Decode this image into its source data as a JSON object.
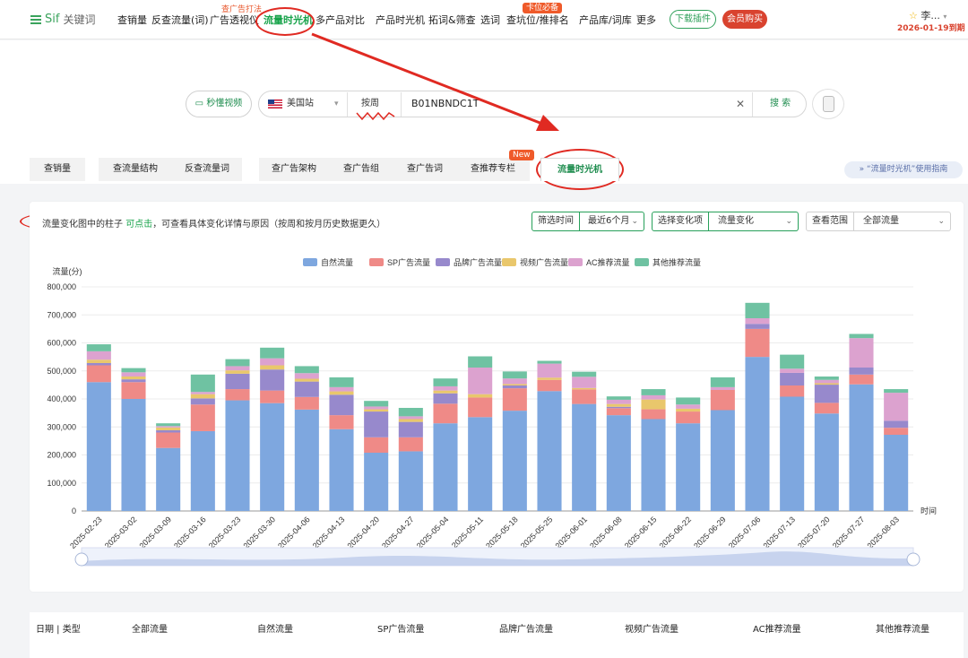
{
  "header": {
    "logo_main": "Sif",
    "logo_sub": "关键词",
    "nav": [
      {
        "label": "查销量"
      },
      {
        "label": "反查流量(词)"
      },
      {
        "label": "广告透视仪"
      },
      {
        "label": "流量时光机",
        "active": true
      },
      {
        "label": "多产品对比"
      },
      {
        "label": "产品时光机"
      },
      {
        "label": "拓词&筛查"
      },
      {
        "label": "选词"
      },
      {
        "label": "查坑位/推排名"
      },
      {
        "label": "产品库/词库"
      },
      {
        "label": "更多"
      }
    ],
    "tag_ad_trick": "查广告打法",
    "tag_top_rank": "卡位必备",
    "download_label": "下载插件",
    "vip_label": "会员购买",
    "user_name": "李...",
    "expire_text": "2026-01-19到期"
  },
  "search": {
    "video_btn": "秒懂视频",
    "site": "美国站",
    "period": "按周",
    "keyword": "B01NBNDC1T",
    "clear_icon": "✕",
    "search_btn": "搜 索"
  },
  "tabs": [
    {
      "label": "查销量"
    },
    {
      "label": "查流量结构"
    },
    {
      "label": "反查流量词"
    },
    {
      "label": "查广告架构"
    },
    {
      "label": "查广告组"
    },
    {
      "label": "查广告词"
    },
    {
      "label": "查推荐专栏"
    },
    {
      "label": "流量时光机",
      "active": true
    }
  ],
  "new_badge": "New",
  "guide_link": "“流量时光机”使用指南",
  "hint": {
    "pre": "流量变化图中的柱子",
    "link": "可点击",
    "post": "，可查看具体变化详情与原因（按周和按月历史数据更久）"
  },
  "filters": {
    "time_label": "筛选时间",
    "time_value": "最近6个月",
    "change_label": "选择变化项",
    "change_value": "流量变化",
    "scope_label": "查看范围",
    "scope_value": "全部流量"
  },
  "colors": {
    "brand_green": "#1f8d4f",
    "red": "#d9432f"
  },
  "chart_data": {
    "type": "bar",
    "stacked": true,
    "ylabel": "流量(分)",
    "xlabel": "时间",
    "ylim": [
      0,
      800000
    ],
    "yticks": [
      "0",
      "100,000",
      "200,000",
      "300,000",
      "400,000",
      "500,000",
      "600,000",
      "700,000",
      "800,000"
    ],
    "legend_position": "top-center",
    "categories": [
      "2025-02-23",
      "2025-03-02",
      "2025-03-09",
      "2025-03-16",
      "2025-03-23",
      "2025-03-30",
      "2025-04-06",
      "2025-04-13",
      "2025-04-20",
      "2025-04-27",
      "2025-05-04",
      "2025-05-11",
      "2025-05-18",
      "2025-05-25",
      "2025-06-01",
      "2025-06-08",
      "2025-06-15",
      "2025-06-22",
      "2025-06-29",
      "2025-07-06",
      "2025-07-13",
      "2025-07-20",
      "2025-07-27",
      "2025-08-03"
    ],
    "series": [
      {
        "name": "自然流量",
        "color": "#7ea7df",
        "values": [
          460000,
          400000,
          225000,
          285000,
          395000,
          385000,
          362000,
          292000,
          208000,
          213000,
          313000,
          335000,
          358000,
          428000,
          382000,
          342000,
          328000,
          313000,
          360000,
          550000,
          408000,
          348000,
          452000,
          272000
        ]
      },
      {
        "name": "SP广告流量",
        "color": "#ef8a87",
        "values": [
          60000,
          60000,
          55000,
          95000,
          40000,
          45000,
          45000,
          50000,
          55000,
          50000,
          70000,
          70000,
          80000,
          40000,
          52000,
          25000,
          35000,
          42000,
          72000,
          100000,
          40000,
          38000,
          35000,
          25000
        ]
      },
      {
        "name": "品牌广告流量",
        "color": "#9789cc",
        "values": [
          8000,
          10000,
          8000,
          22000,
          55000,
          75000,
          55000,
          73000,
          92000,
          55000,
          37000,
          0,
          10000,
          0,
          0,
          5000,
          0,
          0,
          0,
          18000,
          45000,
          65000,
          25000,
          25000
        ]
      },
      {
        "name": "视频广告流量",
        "color": "#e9c76c",
        "values": [
          12000,
          10000,
          10000,
          15000,
          12000,
          15000,
          10000,
          12000,
          8000,
          10000,
          10000,
          12000,
          5000,
          8000,
          5000,
          10000,
          35000,
          10000,
          0,
          0,
          0,
          5000,
          0,
          0
        ]
      },
      {
        "name": "AC推荐流量",
        "color": "#dca2cf",
        "values": [
          30000,
          15000,
          5000,
          8000,
          15000,
          25000,
          20000,
          15000,
          10000,
          10000,
          15000,
          95000,
          20000,
          50000,
          40000,
          15000,
          15000,
          15000,
          10000,
          20000,
          15000,
          12000,
          105000,
          100000
        ]
      },
      {
        "name": "其他推荐流量",
        "color": "#6fc2a2",
        "values": [
          25000,
          15000,
          10000,
          62000,
          25000,
          38000,
          25000,
          35000,
          20000,
          30000,
          28000,
          40000,
          25000,
          10000,
          18000,
          12000,
          22000,
          25000,
          35000,
          55000,
          50000,
          12000,
          15000,
          13000
        ]
      }
    ]
  },
  "table": {
    "headers": [
      "日期 | 类型",
      "全部流量",
      "自然流量",
      "SP广告流量",
      "品牌广告流量",
      "视频广告流量",
      "AC推荐流量",
      "其他推荐流量"
    ]
  }
}
